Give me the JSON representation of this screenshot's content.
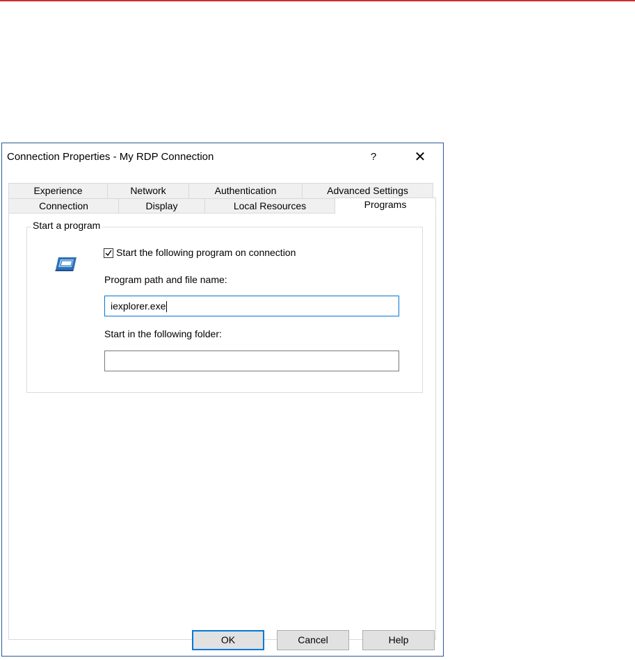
{
  "dialog": {
    "title": "Connection Properties - My RDP Connection",
    "help_glyph": "?",
    "close_glyph": "✕"
  },
  "tabs": {
    "row1": [
      {
        "label": "Experience"
      },
      {
        "label": "Network"
      },
      {
        "label": "Authentication"
      },
      {
        "label": "Advanced Settings"
      }
    ],
    "row2": [
      {
        "label": "Connection"
      },
      {
        "label": "Display"
      },
      {
        "label": "Local Resources"
      },
      {
        "label": "Programs",
        "active": true
      }
    ]
  },
  "programs": {
    "group_label": "Start a program",
    "icon": "remote-program-icon",
    "start_checkbox": {
      "label": "Start the following program on connection",
      "checked": true
    },
    "program_path": {
      "label": "Program path and file name:",
      "value": "iexplorer.exe"
    },
    "start_folder": {
      "label": "Start in the following folder:",
      "value": ""
    }
  },
  "buttons": {
    "ok": "OK",
    "cancel": "Cancel",
    "help": "Help"
  },
  "colors": {
    "accent_line": "#c9302c",
    "focus_border": "#0078d7",
    "window_border": "#2b5797"
  }
}
